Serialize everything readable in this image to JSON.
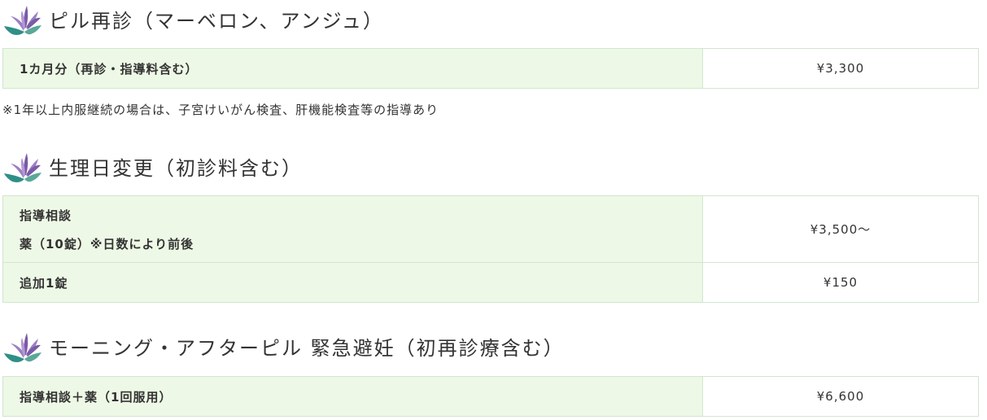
{
  "sections": [
    {
      "icon": "lily-flower-icon",
      "title": "ピル再診（マーベロン、アンジュ）",
      "rows": [
        {
          "item_lines": [
            "1カ月分（再診・指導料含む）"
          ],
          "price": "¥3,300"
        }
      ],
      "note": "※1年以上内服継続の場合は、子宮けいがん検査、肝機能検査等の指導あり"
    },
    {
      "icon": "lily-flower-icon",
      "title": "生理日変更（初診料含む）",
      "rows": [
        {
          "item_lines": [
            "指導相談",
            "薬（10錠）※日数により前後"
          ],
          "price": "¥3,500～"
        },
        {
          "item_lines": [
            "追加1錠"
          ],
          "price": "¥150"
        }
      ]
    },
    {
      "icon": "lily-flower-icon",
      "title": "モーニング・アフターピル 緊急避妊（初再診療含む）",
      "rows": [
        {
          "item_lines": [
            "指導相談＋薬（1回服用）"
          ],
          "price": "¥6,600"
        }
      ]
    }
  ],
  "colors": {
    "item_bg": "#eef8e6",
    "border": "#cfe6cf",
    "text": "#333333",
    "icon_purple": "#7b5aa6",
    "icon_teal": "#2f8f86"
  }
}
